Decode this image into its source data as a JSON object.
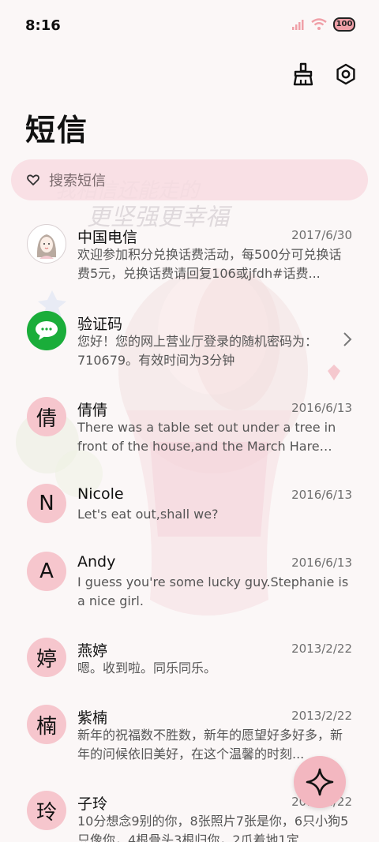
{
  "status_bar": {
    "time": "8:16",
    "battery": "100"
  },
  "page": {
    "title": "短信"
  },
  "search": {
    "placeholder": "搜索短信"
  },
  "conversations": [
    {
      "name": "中国电信",
      "date": "2017/6/30",
      "snippet": "欢迎参加积分兑换话费活动，每500分可兑换话费5元，兑换话费请回复106或jfdh#话费...",
      "avatar": "photo"
    },
    {
      "name": "验证码",
      "date": "",
      "snippet": "您好！您的网上营业厅登录的随机密码为：710679。有效时间为3分钟",
      "avatar": "message-icon"
    },
    {
      "name": "倩倩",
      "date": "2016/6/13",
      "snippet": "There was a table set out under a tree in front of the house,and the March Hare and...",
      "avatar": "倩"
    },
    {
      "name": "Nicole",
      "date": "2016/6/13",
      "snippet": "Let's eat out,shall we?",
      "avatar": "N"
    },
    {
      "name": "Andy",
      "date": "2016/6/13",
      "snippet": "I guess you're some lucky guy.Stephanie is a nice girl.",
      "avatar": "A"
    },
    {
      "name": "燕婷",
      "date": "2013/2/22",
      "snippet": "嗯。收到啦。同乐同乐。",
      "avatar": "婷"
    },
    {
      "name": "紫楠",
      "date": "2013/2/22",
      "snippet": "新年的祝福数不胜数，新年的愿望好多好多，新年的问候依旧美好，在这个温馨的时刻...",
      "avatar": "楠"
    },
    {
      "name": "子玲",
      "date": "2013/2/22",
      "snippet": "10分想念9别的你，8张照片7张是你，6只小狗5只像你，4根骨头3根归你，2爪着地1定",
      "avatar": "玲"
    }
  ],
  "icons": {
    "clean": "broom-icon",
    "settings": "settings-icon",
    "fab": "sparkle-icon"
  },
  "colors": {
    "accent": "#f3b7c0",
    "search_bg": "#f8dce2",
    "avatar_bg": "#f6c6cd",
    "green": "#1aad3a"
  }
}
